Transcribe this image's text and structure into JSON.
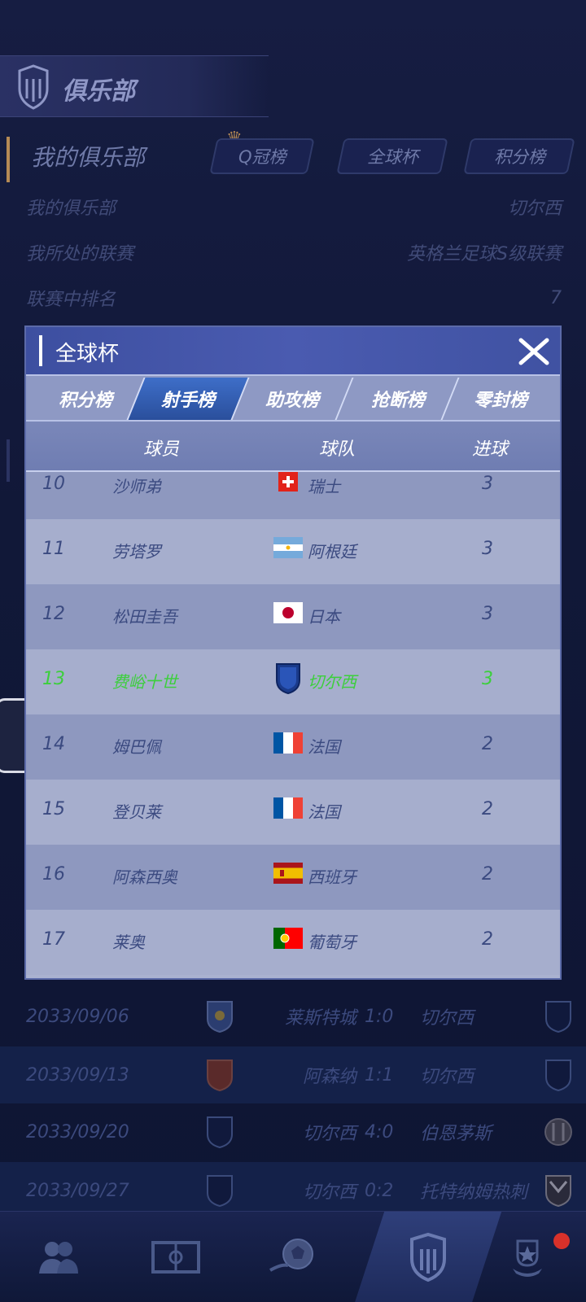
{
  "club_page": {
    "header_title": "俱乐部",
    "section_title": "我的俱乐部",
    "tabs": [
      "Q冠榜",
      "全球杯",
      "积分榜"
    ],
    "info": [
      {
        "label": "我的俱乐部",
        "value": "切尔西"
      },
      {
        "label": "我所处的联赛",
        "value": "英格兰足球S级联赛"
      },
      {
        "label": "联赛中排名",
        "value": "7"
      }
    ],
    "matches": [
      {
        "date": "2033/09/06",
        "home": "莱斯特城",
        "score": "1:0",
        "away": "切尔西"
      },
      {
        "date": "2033/09/13",
        "home": "阿森纳",
        "score": "1:1",
        "away": "切尔西"
      },
      {
        "date": "2033/09/20",
        "home": "切尔西",
        "score": "4:0",
        "away": "伯恩茅斯"
      },
      {
        "date": "2033/09/27",
        "home": "切尔西",
        "score": "0:2",
        "away": "托特纳姆热刺"
      }
    ]
  },
  "bottom_nav": [
    {
      "icon": "players-icon"
    },
    {
      "icon": "pitch-icon"
    },
    {
      "icon": "match-ball-icon"
    },
    {
      "icon": "club-badge-icon"
    },
    {
      "icon": "trophy-icon"
    }
  ],
  "modal": {
    "title": "全球杯",
    "tabs": [
      "积分榜",
      "射手榜",
      "助攻榜",
      "抢断榜",
      "零封榜"
    ],
    "active_tab": "射手榜",
    "columns": {
      "player": "球员",
      "team": "球队",
      "goals": "进球"
    },
    "rows": [
      {
        "rank": "10",
        "player": "沙师弟",
        "team": "瑞士",
        "flag": "switzerland",
        "goals": "3"
      },
      {
        "rank": "11",
        "player": "劳塔罗",
        "team": "阿根廷",
        "flag": "argentina",
        "goals": "3"
      },
      {
        "rank": "12",
        "player": "松田圭吾",
        "team": "日本",
        "flag": "japan",
        "goals": "3"
      },
      {
        "rank": "13",
        "player": "费峪十世",
        "team": "切尔西",
        "flag": "club-shield",
        "goals": "3",
        "highlight": true
      },
      {
        "rank": "14",
        "player": "姆巴佩",
        "team": "法国",
        "flag": "france",
        "goals": "2"
      },
      {
        "rank": "15",
        "player": "登贝莱",
        "team": "法国",
        "flag": "france",
        "goals": "2"
      },
      {
        "rank": "16",
        "player": "阿森西奥",
        "team": "西班牙",
        "flag": "spain",
        "goals": "2"
      },
      {
        "rank": "17",
        "player": "莱奥",
        "team": "葡萄牙",
        "flag": "portugal",
        "goals": "2"
      }
    ]
  },
  "colors": {
    "highlight_text": "#3ccf3c",
    "active_tab": "#3e6ec8",
    "modal_header": "#4a5bb0"
  }
}
